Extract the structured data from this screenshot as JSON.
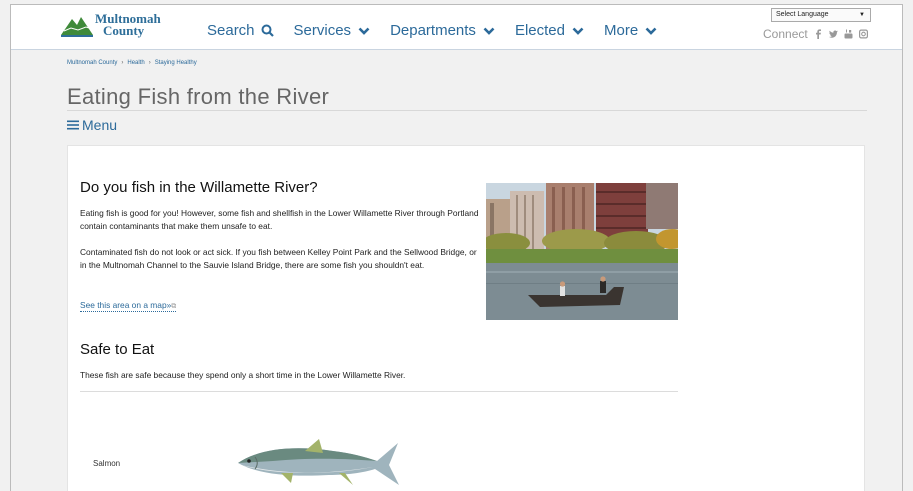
{
  "header": {
    "logo": {
      "line1": "Multnomah",
      "line2": "County"
    },
    "nav": [
      {
        "label": "Search",
        "icon": "search-icon"
      },
      {
        "label": "Services",
        "icon": "chevron-down-icon"
      },
      {
        "label": "Departments",
        "icon": "chevron-down-icon"
      },
      {
        "label": "Elected",
        "icon": "chevron-down-icon"
      },
      {
        "label": "More",
        "icon": "chevron-down-icon"
      }
    ],
    "language_select": "Select Language",
    "connect_label": "Connect",
    "social_icons": [
      "facebook-icon",
      "twitter-icon",
      "youtube-icon",
      "instagram-icon"
    ]
  },
  "breadcrumb": [
    "Multnomah County",
    "Health",
    "Staying Healthy"
  ],
  "page": {
    "title": "Eating Fish from the River",
    "menu_label": "Menu"
  },
  "content": {
    "heading1": "Do you fish in the Willamette River?",
    "para1": "Eating fish is good for you! However, some fish and shellfish in the Lower Willamette River through Portland contain contaminants that make them unsafe to eat.",
    "para2": "Contaminated fish do not look or act sick. If you fish between Kelley Point Park and the Sellwood Bridge, or in the Multnomah Channel to the Sauvie Island Bridge, there are some fish you shouldn't eat.",
    "map_link": "See this area on a map»",
    "heading2": "Safe to Eat",
    "para3": "These fish are safe because they spend only a short time in the Lower Willamette River.",
    "fish": [
      {
        "name": "Salmon"
      }
    ]
  },
  "colors": {
    "link": "#2c6a9a",
    "logo_green": "#3f8a3a",
    "title_gray": "#666666"
  }
}
